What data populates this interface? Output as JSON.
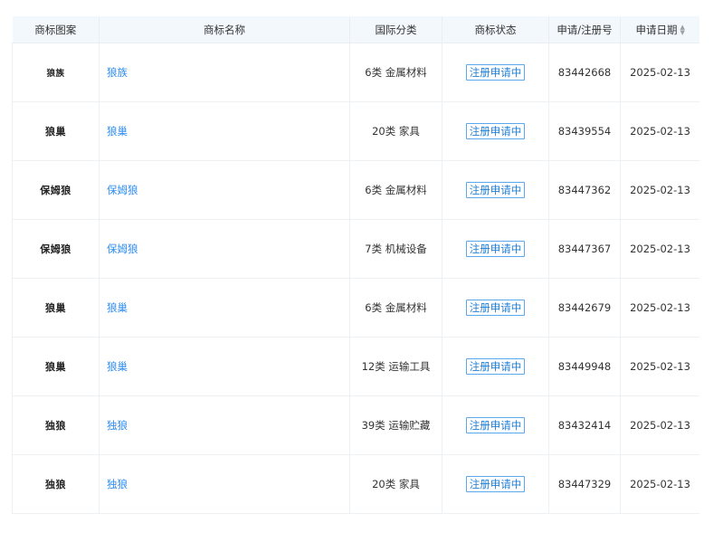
{
  "table": {
    "headers": {
      "image": "商标图案",
      "name": "商标名称",
      "class": "国际分类",
      "status": "商标状态",
      "reg_no": "申请/注册号",
      "date": "申请日期"
    },
    "rows": [
      {
        "logo": "狼族",
        "name": "狼族",
        "class": "6类 金属材料",
        "status": "注册申请中",
        "reg_no": "83442668",
        "date": "2025-02-13"
      },
      {
        "logo": "狼巢",
        "name": "狼巢",
        "class": "20类 家具",
        "status": "注册申请中",
        "reg_no": "83439554",
        "date": "2025-02-13"
      },
      {
        "logo": "保姆狼",
        "name": "保姆狼",
        "class": "6类 金属材料",
        "status": "注册申请中",
        "reg_no": "83447362",
        "date": "2025-02-13"
      },
      {
        "logo": "保姆狼",
        "name": "保姆狼",
        "class": "7类 机械设备",
        "status": "注册申请中",
        "reg_no": "83447367",
        "date": "2025-02-13"
      },
      {
        "logo": "狼巢",
        "name": "狼巢",
        "class": "6类 金属材料",
        "status": "注册申请中",
        "reg_no": "83442679",
        "date": "2025-02-13"
      },
      {
        "logo": "狼巢",
        "name": "狼巢",
        "class": "12类 运输工具",
        "status": "注册申请中",
        "reg_no": "83449948",
        "date": "2025-02-13"
      },
      {
        "logo": "独狼",
        "name": "独狼",
        "class": "39类 运输贮藏",
        "status": "注册申请中",
        "reg_no": "83432414",
        "date": "2025-02-13"
      },
      {
        "logo": "独狼",
        "name": "独狼",
        "class": "20类 家具",
        "status": "注册申请中",
        "reg_no": "83447329",
        "date": "2025-02-13"
      }
    ]
  }
}
